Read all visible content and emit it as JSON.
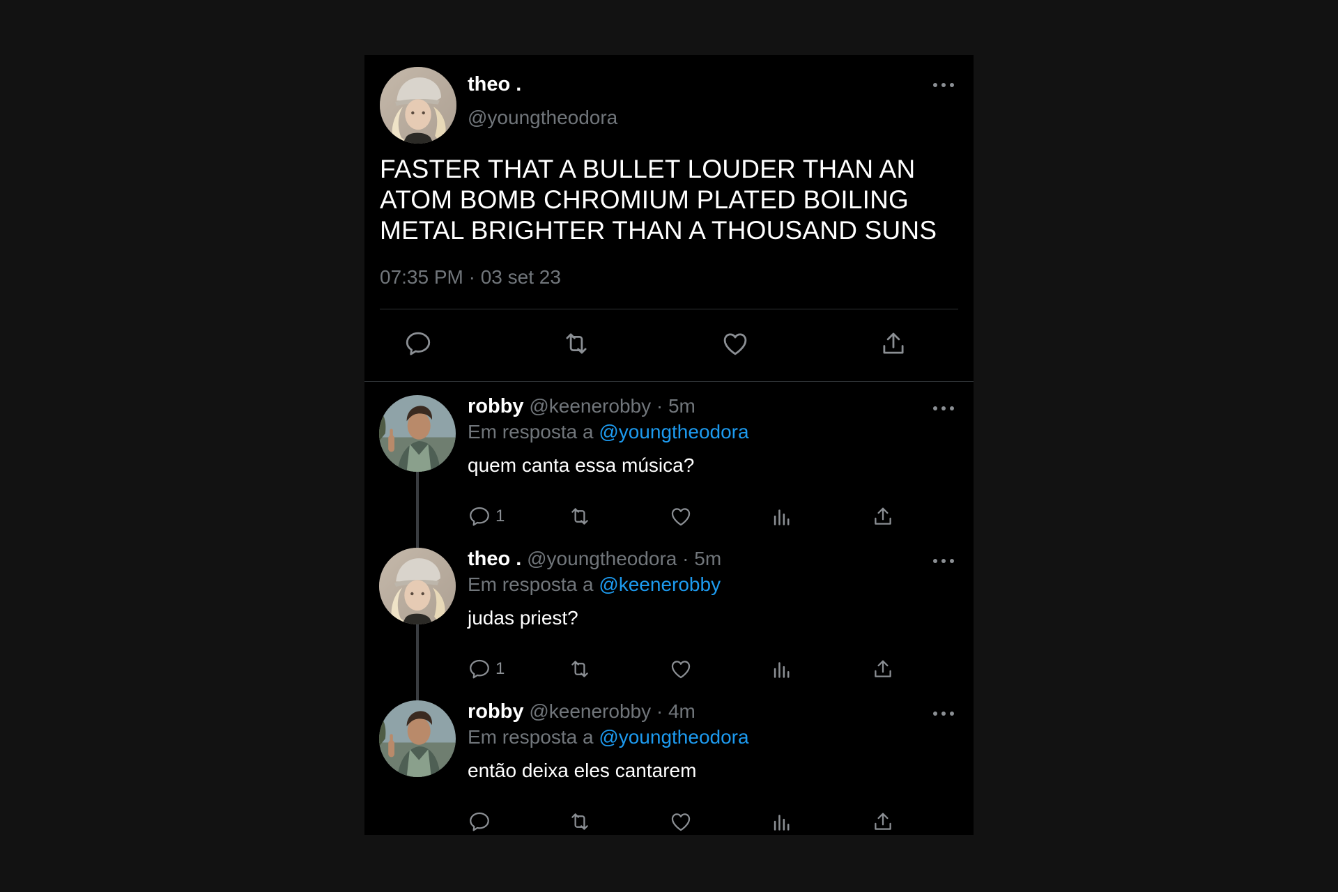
{
  "main_tweet": {
    "display_name": "theo .",
    "handle": "@youngtheodora",
    "text": "FASTER THAT A BULLET LOUDER THAN AN ATOM BOMB CHROMIUM PLATED BOILING METAL BRIGHTER THAN A THOUSAND SUNS",
    "timestamp": "07:35 PM · 03 set 23",
    "avatar_icon": "avatar-theo",
    "actions": [
      "reply-icon",
      "retweet-icon",
      "like-icon",
      "share-icon"
    ]
  },
  "replies": [
    {
      "display_name": "robby",
      "meta": " @keenerobby · 5m",
      "replying_prefix": "Em resposta a ",
      "replying_to": "@youngtheodora",
      "text": "quem canta essa música?",
      "reply_count": "1",
      "avatar_icon": "avatar-robby"
    },
    {
      "display_name": "theo .",
      "meta": " @youngtheodora · 5m",
      "replying_prefix": "Em resposta a ",
      "replying_to": "@keenerobby",
      "text": "judas priest?",
      "reply_count": "1",
      "avatar_icon": "avatar-theo"
    },
    {
      "display_name": "robby",
      "meta": " @keenerobby · 4m",
      "replying_prefix": "Em resposta a ",
      "replying_to": "@youngtheodora",
      "text": "então deixa eles cantarem",
      "reply_count": "",
      "avatar_icon": "avatar-robby"
    }
  ],
  "colors": {
    "background": "#121212",
    "card": "#000000",
    "mention": "#1d9bf0",
    "muted": "#71767b"
  }
}
